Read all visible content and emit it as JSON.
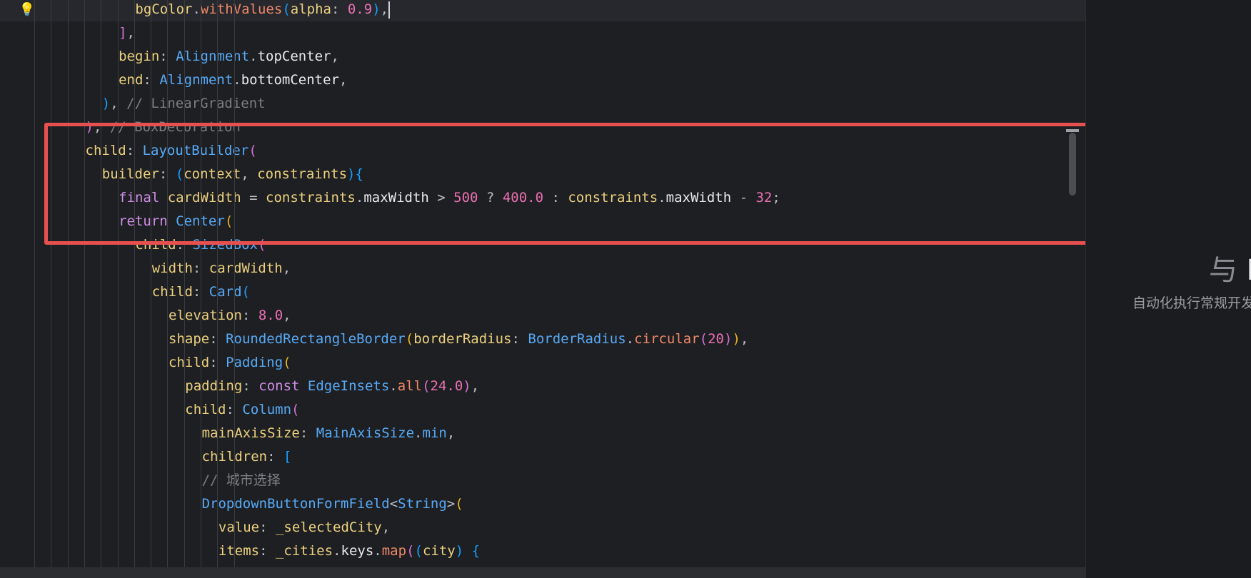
{
  "editor": {
    "lines": [
      [
        [
          "t-key",
          "bgColor"
        ],
        [
          "",
          "."
        ],
        [
          "t-meth",
          "withValues"
        ],
        [
          "t-br3",
          "("
        ],
        [
          "t-key",
          "alpha"
        ],
        [
          "",
          ": "
        ],
        [
          "t-num",
          "0.9"
        ],
        [
          "t-br3",
          ")"
        ],
        [
          "",
          ","
        ]
      ],
      [
        [
          "t-br2",
          "]"
        ],
        [
          "",
          ","
        ]
      ],
      [
        [
          "t-key",
          "begin"
        ],
        [
          "",
          ": "
        ],
        [
          "t-fn",
          "Alignment"
        ],
        [
          "",
          "."
        ],
        [
          "t-id",
          "topCenter"
        ],
        [
          "",
          ","
        ]
      ],
      [
        [
          "t-key",
          "end"
        ],
        [
          "",
          ": "
        ],
        [
          "t-fn",
          "Alignment"
        ],
        [
          "",
          "."
        ],
        [
          "t-id",
          "bottomCenter"
        ],
        [
          "",
          ","
        ]
      ],
      [
        [
          "t-br3",
          ")"
        ],
        [
          "",
          ", "
        ],
        [
          "t-cmt",
          "// LinearGradient"
        ]
      ],
      [
        [
          "t-br2",
          ")"
        ],
        [
          "",
          ", "
        ],
        [
          "t-cmt",
          "// BoxDecoration"
        ]
      ],
      [
        [
          "t-key",
          "child"
        ],
        [
          "",
          ": "
        ],
        [
          "t-fn",
          "LayoutBuilder"
        ],
        [
          "t-br2",
          "("
        ]
      ],
      [
        [
          "t-key",
          "builder"
        ],
        [
          "",
          ": "
        ],
        [
          "t-br3",
          "("
        ],
        [
          "t-key",
          "context"
        ],
        [
          "",
          ", "
        ],
        [
          "t-key",
          "constraints"
        ],
        [
          "t-br3",
          ")"
        ],
        [
          "",
          "",
          " "
        ],
        [
          "t-br3",
          "{"
        ]
      ],
      [
        [
          "t-kw",
          "final "
        ],
        [
          "t-key",
          "cardWidth"
        ],
        [
          "",
          " = "
        ],
        [
          "t-key",
          "constraints"
        ],
        [
          "",
          "."
        ],
        [
          "t-id",
          "maxWidth"
        ],
        [
          "",
          " > "
        ],
        [
          "t-num",
          "500"
        ],
        [
          "",
          " ? "
        ],
        [
          "t-num",
          "400.0"
        ],
        [
          "",
          " : "
        ],
        [
          "t-key",
          "constraints"
        ],
        [
          "",
          "."
        ],
        [
          "t-id",
          "maxWidth"
        ],
        [
          "",
          " - "
        ],
        [
          "t-num",
          "32"
        ],
        [
          "",
          ";"
        ]
      ],
      [
        [
          "t-kw",
          "return "
        ],
        [
          "t-fn",
          "Center"
        ],
        [
          "t-br1",
          "("
        ]
      ],
      [
        [
          "t-key",
          "child"
        ],
        [
          "",
          ": "
        ],
        [
          "t-fn",
          "SizedBox"
        ],
        [
          "t-br2",
          "("
        ]
      ],
      [
        [
          "t-key",
          "width"
        ],
        [
          "",
          ": "
        ],
        [
          "t-key",
          "cardWidth"
        ],
        [
          "",
          ","
        ]
      ],
      [
        [
          "t-key",
          "child"
        ],
        [
          "",
          ": "
        ],
        [
          "t-fn",
          "Card"
        ],
        [
          "t-br3",
          "("
        ]
      ],
      [
        [
          "t-key",
          "elevation"
        ],
        [
          "",
          ": "
        ],
        [
          "t-num",
          "8.0"
        ],
        [
          "",
          ","
        ]
      ],
      [
        [
          "t-key",
          "shape"
        ],
        [
          "",
          ": "
        ],
        [
          "t-fn",
          "RoundedRectangleBorder"
        ],
        [
          "t-br1",
          "("
        ],
        [
          "t-key",
          "borderRadius"
        ],
        [
          "",
          ": "
        ],
        [
          "t-fn",
          "BorderRadius"
        ],
        [
          "",
          "."
        ],
        [
          "t-meth",
          "circular"
        ],
        [
          "t-br2",
          "("
        ],
        [
          "t-num",
          "20"
        ],
        [
          "t-br2",
          ")"
        ],
        [
          "t-br1",
          ")"
        ],
        [
          "",
          ","
        ]
      ],
      [
        [
          "t-key",
          "child"
        ],
        [
          "",
          ": "
        ],
        [
          "t-fn",
          "Padding"
        ],
        [
          "t-br1",
          "("
        ]
      ],
      [
        [
          "t-key",
          "padding"
        ],
        [
          "",
          ": "
        ],
        [
          "t-kw",
          "const "
        ],
        [
          "t-fn",
          "EdgeInsets"
        ],
        [
          "",
          "."
        ],
        [
          "t-meth",
          "all"
        ],
        [
          "t-br2",
          "("
        ],
        [
          "t-num",
          "24.0"
        ],
        [
          "t-br2",
          ")"
        ],
        [
          "",
          ","
        ]
      ],
      [
        [
          "t-key",
          "child"
        ],
        [
          "",
          ": "
        ],
        [
          "t-fn",
          "Column"
        ],
        [
          "t-br2",
          "("
        ]
      ],
      [
        [
          "t-key",
          "mainAxisSize"
        ],
        [
          "",
          ": "
        ],
        [
          "t-fn",
          "MainAxisSize"
        ],
        [
          "",
          "."
        ],
        [
          "t-str",
          "min"
        ],
        [
          "",
          ","
        ]
      ],
      [
        [
          "t-key",
          "children"
        ],
        [
          "",
          ": "
        ],
        [
          "t-br3",
          "["
        ]
      ],
      [
        [
          "t-cmt",
          "// 城市选择"
        ]
      ],
      [
        [
          "t-fn",
          "DropdownButtonFormField"
        ],
        [
          "",
          "<"
        ],
        [
          "t-fn",
          "String"
        ],
        [
          "",
          ">"
        ],
        [
          "t-br1",
          "("
        ]
      ],
      [
        [
          "t-key",
          "value"
        ],
        [
          "",
          ": "
        ],
        [
          "t-key",
          "_selectedCity"
        ],
        [
          "",
          ","
        ]
      ],
      [
        [
          "t-key",
          "items"
        ],
        [
          "",
          ": "
        ],
        [
          "t-key",
          "_cities"
        ],
        [
          "",
          "."
        ],
        [
          "t-id",
          "keys"
        ],
        [
          "",
          "."
        ],
        [
          "t-meth",
          "map"
        ],
        [
          "t-br2",
          "("
        ],
        [
          "t-br3",
          "("
        ],
        [
          "t-key",
          "city"
        ],
        [
          "t-br3",
          ")"
        ],
        [
          "",
          " "
        ],
        [
          "t-br3",
          "{"
        ]
      ]
    ]
  },
  "panel": {
    "heading_glyph": "与",
    "heading_tail": "E",
    "subtitle": "自动化执行常规开发"
  }
}
